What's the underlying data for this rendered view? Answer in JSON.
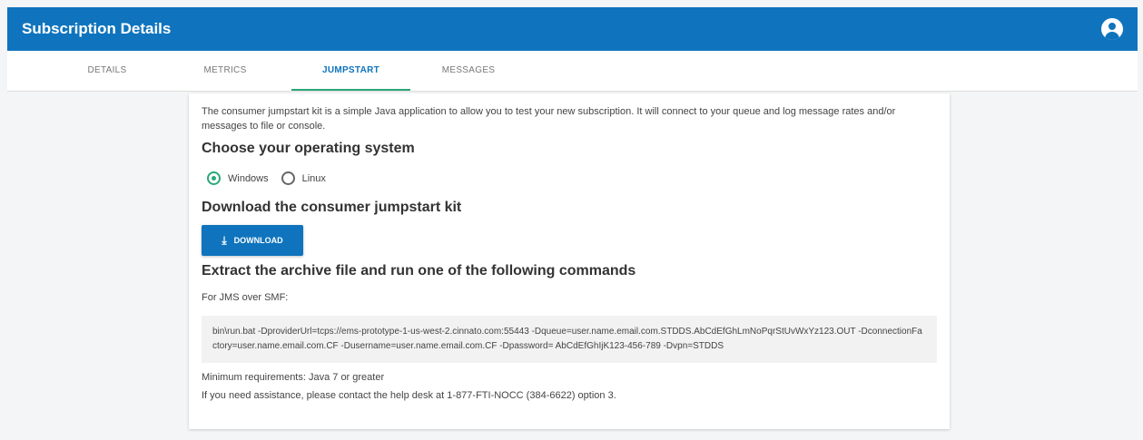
{
  "header": {
    "title": "Subscription Details",
    "account_icon": "account-circle-icon"
  },
  "tabs": [
    {
      "label": "DETAILS",
      "active": false
    },
    {
      "label": "METRICS",
      "active": false
    },
    {
      "label": "JUMPSTART",
      "active": true
    },
    {
      "label": "MESSAGES",
      "active": false
    }
  ],
  "content": {
    "intro": "The consumer jumpstart kit is a simple Java application to allow you to test your new subscription. It will connect to your queue and log message rates and/or messages to file or console.",
    "os_heading": "Choose your operating system",
    "os_options": [
      {
        "label": "Windows",
        "checked": true
      },
      {
        "label": "Linux",
        "checked": false
      }
    ],
    "download_heading": "Download the consumer jumpstart kit",
    "download_button": "DOWNLOAD",
    "download_icon": "download-icon",
    "extract_heading": "Extract the archive file and run one of the following commands",
    "jms_label": "For JMS over SMF:",
    "command": "bin\\run.bat -DproviderUrl=tcps://ems-prototype-1-us-west-2.cinnato.com:55443 -Dqueue=user.name.email.com.STDDS.AbCdEfGhLmNoPqrStUvWxYz123.OUT -DconnectionFactory=user.name.email.com.CF -Dusername=user.name.email.com.CF -Dpassword= AbCdEfGhIjK123-456-789 -Dvpn=STDDS",
    "min_req": "Minimum requirements: Java 7 or greater",
    "help": "If you need assistance, please contact the help desk at 1-877-FTI-NOCC (384-6622) option 3."
  },
  "colors": {
    "header_bg": "#0f74bd",
    "accent": "#2aa878",
    "button_bg": "#0f74bd"
  }
}
